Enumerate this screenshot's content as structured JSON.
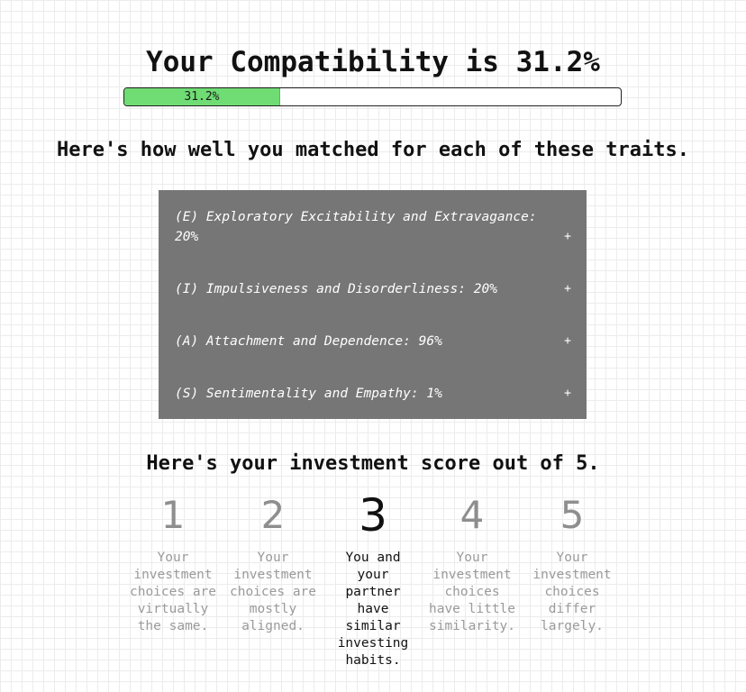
{
  "header": {
    "title": "Your Compatibility is 31.2%",
    "progress_label": "31.2%",
    "progress_fraction": 0.312,
    "progress_color": "#6fdc74"
  },
  "traits_section": {
    "heading": "Here's how well you matched for each of these traits.",
    "background_color": "#767676",
    "items": [
      {
        "label": "(E) Exploratory Excitability and Extravagance: 20%",
        "toggle": "+"
      },
      {
        "label": "(I) Impulsiveness and Disorderliness: 20%",
        "toggle": "+"
      },
      {
        "label": "(A) Attachment and Dependence: 96%",
        "toggle": "+"
      },
      {
        "label": "(S) Sentimentality and Empathy: 1%",
        "toggle": "+"
      }
    ]
  },
  "investment": {
    "heading_prefix": "Here's your ",
    "heading_bold": "investment",
    "heading_suffix": " score out of 5.",
    "selected": 3,
    "scores": [
      {
        "number": "1",
        "description": "Your investment choices are virtually the same."
      },
      {
        "number": "2",
        "description": "Your investment choices are mostly aligned."
      },
      {
        "number": "3",
        "description": "You and your partner have similar investing habits."
      },
      {
        "number": "4",
        "description": "Your investment choices have little similarity."
      },
      {
        "number": "5",
        "description": "Your investment choices differ largely."
      }
    ]
  }
}
